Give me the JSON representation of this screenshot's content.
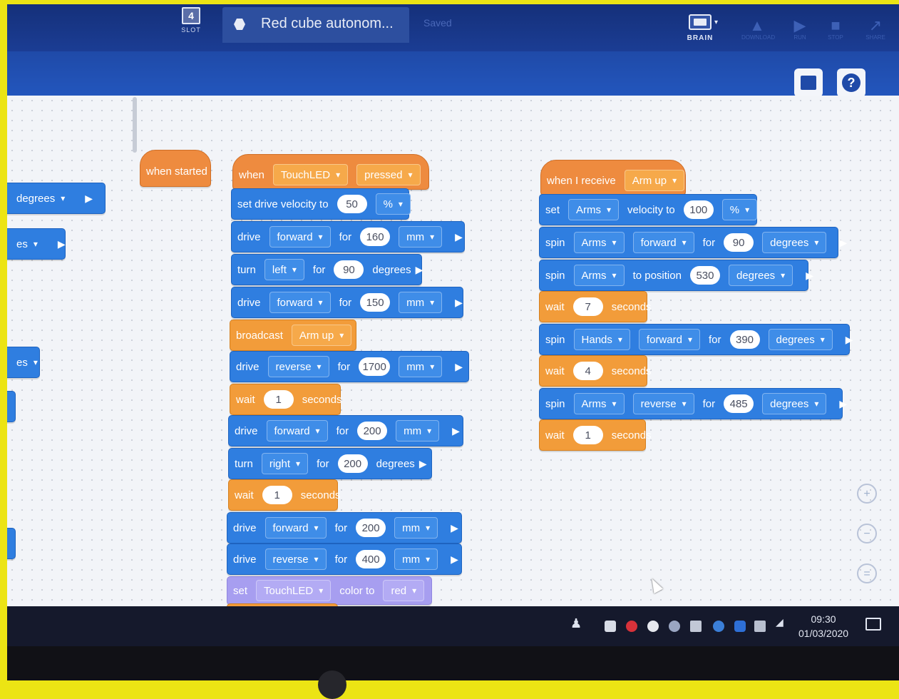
{
  "titlebar": {
    "slot_number": "4",
    "slot_label": "SLOT",
    "project_name": "Red cube autonom...",
    "saved_label": "Saved",
    "brain_label": "BRAIN",
    "dim_buttons": [
      "DOWNLOAD",
      "RUN",
      "STOP",
      "SHARE"
    ]
  },
  "left_blocks": {
    "degrees_label": "degrees",
    "partial_es_1": "es",
    "partial_es_2": "es"
  },
  "stacks": {
    "when_started": "when started",
    "main": {
      "hat": {
        "when": "when",
        "device": "TouchLED",
        "event": "pressed"
      },
      "set_velocity": {
        "text": "set drive velocity to",
        "value": "50",
        "unit": "%"
      },
      "drive1": {
        "cmd": "drive",
        "dir": "forward",
        "for": "for",
        "value": "160",
        "unit": "mm"
      },
      "turn1": {
        "cmd": "turn",
        "dir": "left",
        "for": "for",
        "value": "90",
        "unit": "degrees"
      },
      "drive2": {
        "cmd": "drive",
        "dir": "forward",
        "for": "for",
        "value": "150",
        "unit": "mm"
      },
      "broadcast": {
        "cmd": "broadcast",
        "msg": "Arm up"
      },
      "drive3": {
        "cmd": "drive",
        "dir": "reverse",
        "for": "for",
        "value": "1700",
        "unit": "mm"
      },
      "wait1": {
        "cmd": "wait",
        "value": "1",
        "unit": "seconds"
      },
      "drive4": {
        "cmd": "drive",
        "dir": "forward",
        "for": "for",
        "value": "200",
        "unit": "mm"
      },
      "turn2": {
        "cmd": "turn",
        "dir": "right",
        "for": "for",
        "value": "200",
        "unit": "degrees"
      },
      "wait2": {
        "cmd": "wait",
        "value": "1",
        "unit": "seconds"
      },
      "drive5": {
        "cmd": "drive",
        "dir": "forward",
        "for": "for",
        "value": "200",
        "unit": "mm"
      },
      "drive6": {
        "cmd": "drive",
        "dir": "reverse",
        "for": "for",
        "value": "400",
        "unit": "mm"
      },
      "set_color": {
        "cmd": "set",
        "device": "TouchLED",
        "mid": "color to",
        "color": "red"
      }
    },
    "receive": {
      "hat": {
        "text": "when I receive",
        "msg": "Arm up"
      },
      "set_arms": {
        "cmd": "set",
        "motor": "Arms",
        "mid": "velocity to",
        "value": "100",
        "unit": "%"
      },
      "spin1": {
        "cmd": "spin",
        "motor": "Arms",
        "dir": "forward",
        "for": "for",
        "value": "90",
        "unit": "degrees"
      },
      "spin2": {
        "cmd": "spin",
        "motor": "Arms",
        "mid": "to position",
        "value": "530",
        "unit": "degrees"
      },
      "wait1": {
        "cmd": "wait",
        "value": "7",
        "unit": "seconds"
      },
      "spin3": {
        "cmd": "spin",
        "motor": "Hands",
        "dir": "forward",
        "for": "for",
        "value": "390",
        "unit": "degrees"
      },
      "wait2": {
        "cmd": "wait",
        "value": "4",
        "unit": "seconds"
      },
      "spin4": {
        "cmd": "spin",
        "motor": "Arms",
        "dir": "reverse",
        "for": "for",
        "value": "485",
        "unit": "degrees"
      },
      "wait3": {
        "cmd": "wait",
        "value": "1",
        "unit": "seconds"
      }
    }
  },
  "zoom": {
    "in": "+",
    "out": "−",
    "reset": "="
  },
  "taskbar": {
    "time": "09:30",
    "date": "01/03/2020"
  },
  "colors": {
    "blue_block": "#2f7ee0",
    "orange_block": "#f29c3a",
    "purple_block": "#a79ef0",
    "hat_orange": "#ee8b3f"
  },
  "icons": [
    "slot-icon",
    "hex-icon",
    "brain-icon",
    "book-icon",
    "help-icon",
    "zoom-in-icon",
    "zoom-out-icon",
    "zoom-reset-icon",
    "cursor-icon",
    "notification-icon"
  ]
}
